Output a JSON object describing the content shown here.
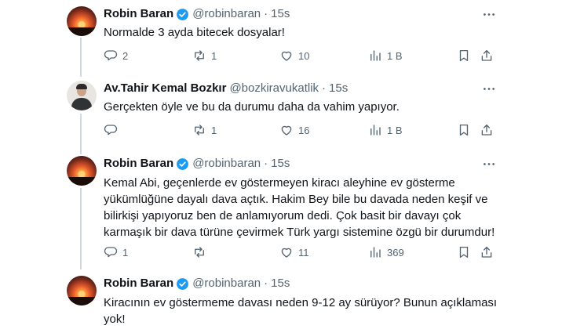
{
  "tweets": [
    {
      "name": "Robin Baran",
      "handle": "@robinbaran",
      "separator": "·",
      "time": "15s",
      "text": "Normalde 3 ayda bitecek dosyalar!",
      "replies": "2",
      "retweets": "1",
      "likes": "10",
      "views": "1 B"
    },
    {
      "name": "Av.Tahir Kemal Bozkır",
      "handle": "@bozkiravukatlik",
      "separator": "·",
      "time": "15s",
      "text": "Gerçekten öyle ve bu da durumu daha da vahim yapıyor.",
      "replies": "",
      "retweets": "1",
      "likes": "16",
      "views": "1 B"
    },
    {
      "name": "Robin Baran",
      "handle": "@robinbaran",
      "separator": "·",
      "time": "15s",
      "text": "Kemal Abi, geçenlerde ev göstermeyen kiracı aleyhine ev gösterme\nyükümlüğüne dayalı dava açtık. Hakim Bey bile bu davada neden keşif ve\nbilirkişi yapıyoruz ben de anlamıyorum dedi. Çok basit bir davayı çok\nkarmaşık bir dava türüne çevirmek Türk yargı sistemine özgü bir durumdur!",
      "replies": "1",
      "retweets": "",
      "likes": "11",
      "views": "369"
    },
    {
      "name": "Robin Baran",
      "handle": "@robinbaran",
      "separator": "·",
      "time": "15s",
      "text": "Kiracının ev göstermeme davası neden 9-12 ay sürüyor? Bunun açıklaması\nyok!"
    }
  ],
  "colors": {
    "verified": "#1d9bf0",
    "muted": "#536471",
    "thread_line": "#cfd9de"
  }
}
